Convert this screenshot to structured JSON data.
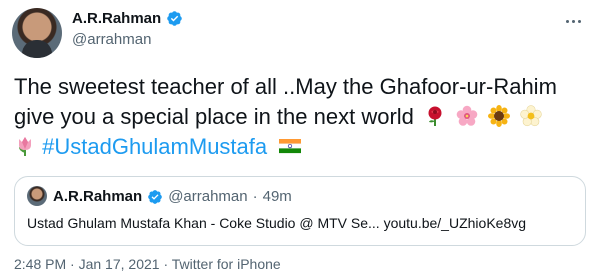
{
  "author": {
    "display_name": "A.R.Rahman",
    "handle": "@arrahman"
  },
  "tweet": {
    "line1": "The sweetest teacher of all ..May the Ghafoor-ur-Rahim",
    "line2": "give you a special  place  in the next world",
    "hashtag": "#UstadGhulamMustafa",
    "emojis": [
      "rose",
      "cherry-blossom",
      "sunflower",
      "blossom",
      "tulip",
      "india-flag"
    ]
  },
  "quote": {
    "display_name": "A.R.Rahman",
    "handle": "@arrahman",
    "separator": "·",
    "age": "49m",
    "text": "Ustad Ghulam Mustafa Khan - Coke Studio @ MTV Se... youtu.be/_UZhioKe8vg"
  },
  "footer": {
    "time": "2:48 PM",
    "date": "Jan 17, 2021",
    "source": "Twitter for iPhone",
    "separator": "·"
  },
  "colors": {
    "link": "#1d9bf0",
    "secondary_text": "#536471",
    "border": "#cfd9de",
    "verified": "#1d9bf0"
  }
}
